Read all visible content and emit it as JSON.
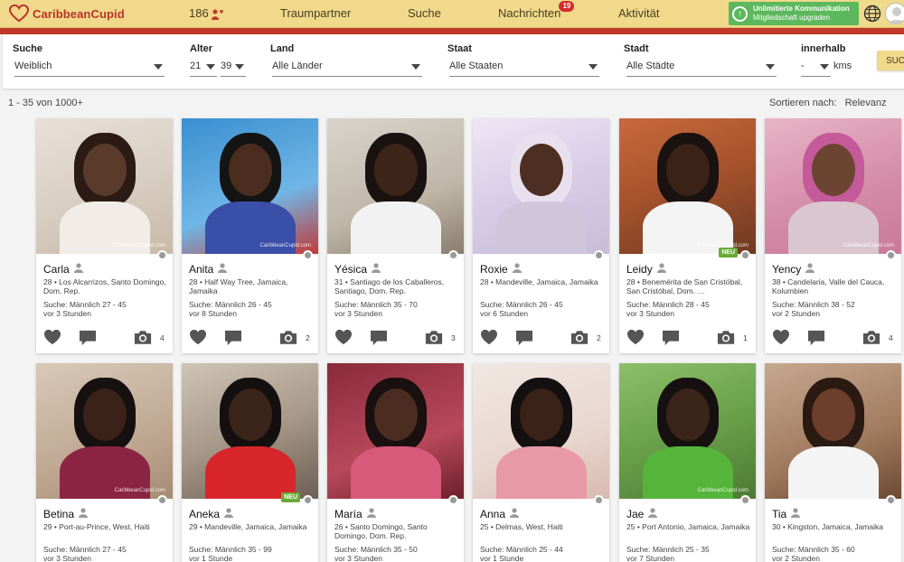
{
  "header": {
    "logo_text": "CaribbeanCupid",
    "count": "186",
    "nav": [
      "Traumpartner",
      "Suche",
      "Nachrichten",
      "Aktivität"
    ],
    "messages_badge": "19",
    "upgrade_line1": "Unlimitierte Kommunikation",
    "upgrade_line2": "Mitgliedschaft upgraden",
    "upgrade_icon": "↑"
  },
  "search": {
    "label_search": "Suche",
    "value_search": "Weiblich",
    "label_age": "Alter",
    "age_min": "21",
    "age_max": "39",
    "label_country": "Land",
    "value_country": "Alle Länder",
    "label_state": "Staat",
    "value_state": "Alle Staaten",
    "label_city": "Stadt",
    "value_city": "Alle Städte",
    "label_within": "innerhalb",
    "value_within": "-",
    "unit": "kms",
    "button": "SUC"
  },
  "results": {
    "count_text": "1 - 35 von 1000+",
    "sort_label": "Sortieren nach:",
    "sort_value": "Relevanz"
  },
  "colors": {
    "topbar": "#f0d98a",
    "accent_red": "#c0392b",
    "upgrade_green": "#5cb85c",
    "neu_green": "#6aaa3a"
  },
  "profiles": [
    {
      "name": "Carla",
      "location": "28 • Los Alcarrizos, Santo Domingo, Dom. Rep.",
      "seeking": "Suche: Männlich 27 - 45",
      "last_seen": "vor 3 Stunden",
      "photos": "4",
      "neu": "",
      "watermark": "CaribbeanCupid.com"
    },
    {
      "name": "Anita",
      "location": "28 • Half Way Tree, Jamaica, Jamaika",
      "seeking": "Suche: Männlich 26 - 45",
      "last_seen": "vor 8 Stunden",
      "photos": "2",
      "neu": "",
      "watermark": "CaribbeanCupid.com"
    },
    {
      "name": "Yésica",
      "location": "31 • Santiago de los Caballeros, Santiago, Dom. Rep.",
      "seeking": "Suche: Männlich 35 - 70",
      "last_seen": "vor 3 Stunden",
      "photos": "3",
      "neu": "",
      "watermark": ""
    },
    {
      "name": "Roxie",
      "location": "28 • Mandeville, Jamaica, Jamaika",
      "seeking": "Suche: Männlich 26 - 45",
      "last_seen": "vor 6 Stunden",
      "photos": "2",
      "neu": "",
      "watermark": ""
    },
    {
      "name": "Leidy",
      "location": "28 • Benemérita de San Cristóbal, San Cristóbal, Dom. …",
      "seeking": "Suche: Männlich 28 - 45",
      "last_seen": "vor 3 Stunden",
      "photos": "1",
      "neu": "NEU",
      "watermark": "CaribbeanCupid.com"
    },
    {
      "name": "Yency",
      "location": "38 • Candelaria, Valle del Cauca, Kolumbien",
      "seeking": "Suche: Männlich 38 - 52",
      "last_seen": "vor 2 Stunden",
      "photos": "4",
      "neu": "",
      "watermark": "CaribbeanCupid.com"
    },
    {
      "name": "Betina",
      "location": "29 • Port-au-Prince, West, Haiti",
      "seeking": "Suche: Männlich 27 - 45",
      "last_seen": "vor 3 Stunden",
      "photos": "",
      "neu": "",
      "watermark": "CaribbeanCupid.com"
    },
    {
      "name": "Aneka",
      "location": "29 • Mandeville, Jamaica, Jamaika",
      "seeking": "Suche: Männlich 35 - 99",
      "last_seen": "vor 1 Stunde",
      "photos": "",
      "neu": "NEU",
      "watermark": ""
    },
    {
      "name": "María",
      "location": "26 • Santo Domingo, Santo Domingo, Dom. Rep.",
      "seeking": "Suche: Männlich 35 - 50",
      "last_seen": "vor 3 Stunden",
      "photos": "",
      "neu": "",
      "watermark": ""
    },
    {
      "name": "Anna",
      "location": "25 • Delmas, West, Haiti",
      "seeking": "Suche: Männlich 25 - 44",
      "last_seen": "vor 1 Stunde",
      "photos": "",
      "neu": "",
      "watermark": ""
    },
    {
      "name": "Jae",
      "location": "25 • Port Antonio, Jamaica, Jamaika",
      "seeking": "Suche: Männlich 25 - 35",
      "last_seen": "vor 7 Stunden",
      "photos": "",
      "neu": "",
      "watermark": "CaribbeanCupid.com"
    },
    {
      "name": "Tia",
      "location": "30 • Kingston, Jamaica, Jamaika",
      "seeking": "Suche: Männlich 35 - 60",
      "last_seen": "vor 2 Stunden",
      "photos": "",
      "neu": "",
      "watermark": ""
    }
  ]
}
